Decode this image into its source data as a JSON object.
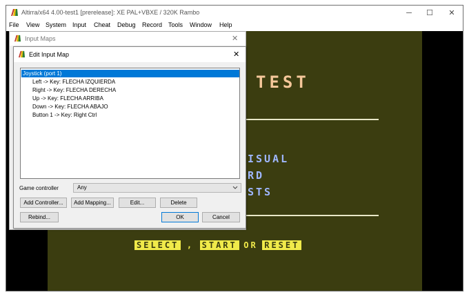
{
  "main_window": {
    "title": "Altirra/x64 4.00-test1 [prerelease]: XE PAL+VBXE / 320K Rambo",
    "caption_buttons": {
      "minimize": "─",
      "maximize": "☐",
      "close": "✕"
    },
    "menu": [
      "File",
      "View",
      "System",
      "Input",
      "Cheat",
      "Debug",
      "Record",
      "Tools",
      "Window",
      "Help"
    ]
  },
  "emulator_screen": {
    "title_word": "TEST",
    "line_visual": "ISUAL",
    "line_rd": "RD",
    "line_sts": "STS",
    "prompt": {
      "select": "SELECT",
      "comma": ",",
      "start": "START",
      "or": "OR",
      "reset": "RESET"
    }
  },
  "input_maps_window": {
    "title": "Input Maps",
    "close": "✕"
  },
  "edit_input_map": {
    "title": "Edit Input Map",
    "close": "✕",
    "tree": {
      "root": "Joystick (port 1)",
      "children": [
        "Left -> Key: FLECHA IZQUIERDA",
        "Right -> Key: FLECHA DERECHA",
        "Up -> Key: FLECHA ARRIBA",
        "Down -> Key: FLECHA ABAJO",
        "Button 1 -> Key: Right Ctrl"
      ]
    },
    "game_controller_label": "Game controller",
    "game_controller_value": "Any",
    "buttons": {
      "add_controller": "Add Controller...",
      "add_mapping": "Add Mapping...",
      "edit": "Edit...",
      "delete": "Delete",
      "rebind": "Rebind...",
      "ok": "OK",
      "cancel": "Cancel"
    }
  },
  "colors": {
    "screen_bg": "#3b3d10",
    "title_text": "#f5c79a",
    "menu_text": "#9fb7ff",
    "prompt_bg": "#f0ea4a",
    "prompt_fg": "#3b3d10",
    "selection": "#0078d7"
  },
  "icons": {
    "app": "altirra-app-icon",
    "chevron": "chevron-down-icon"
  }
}
